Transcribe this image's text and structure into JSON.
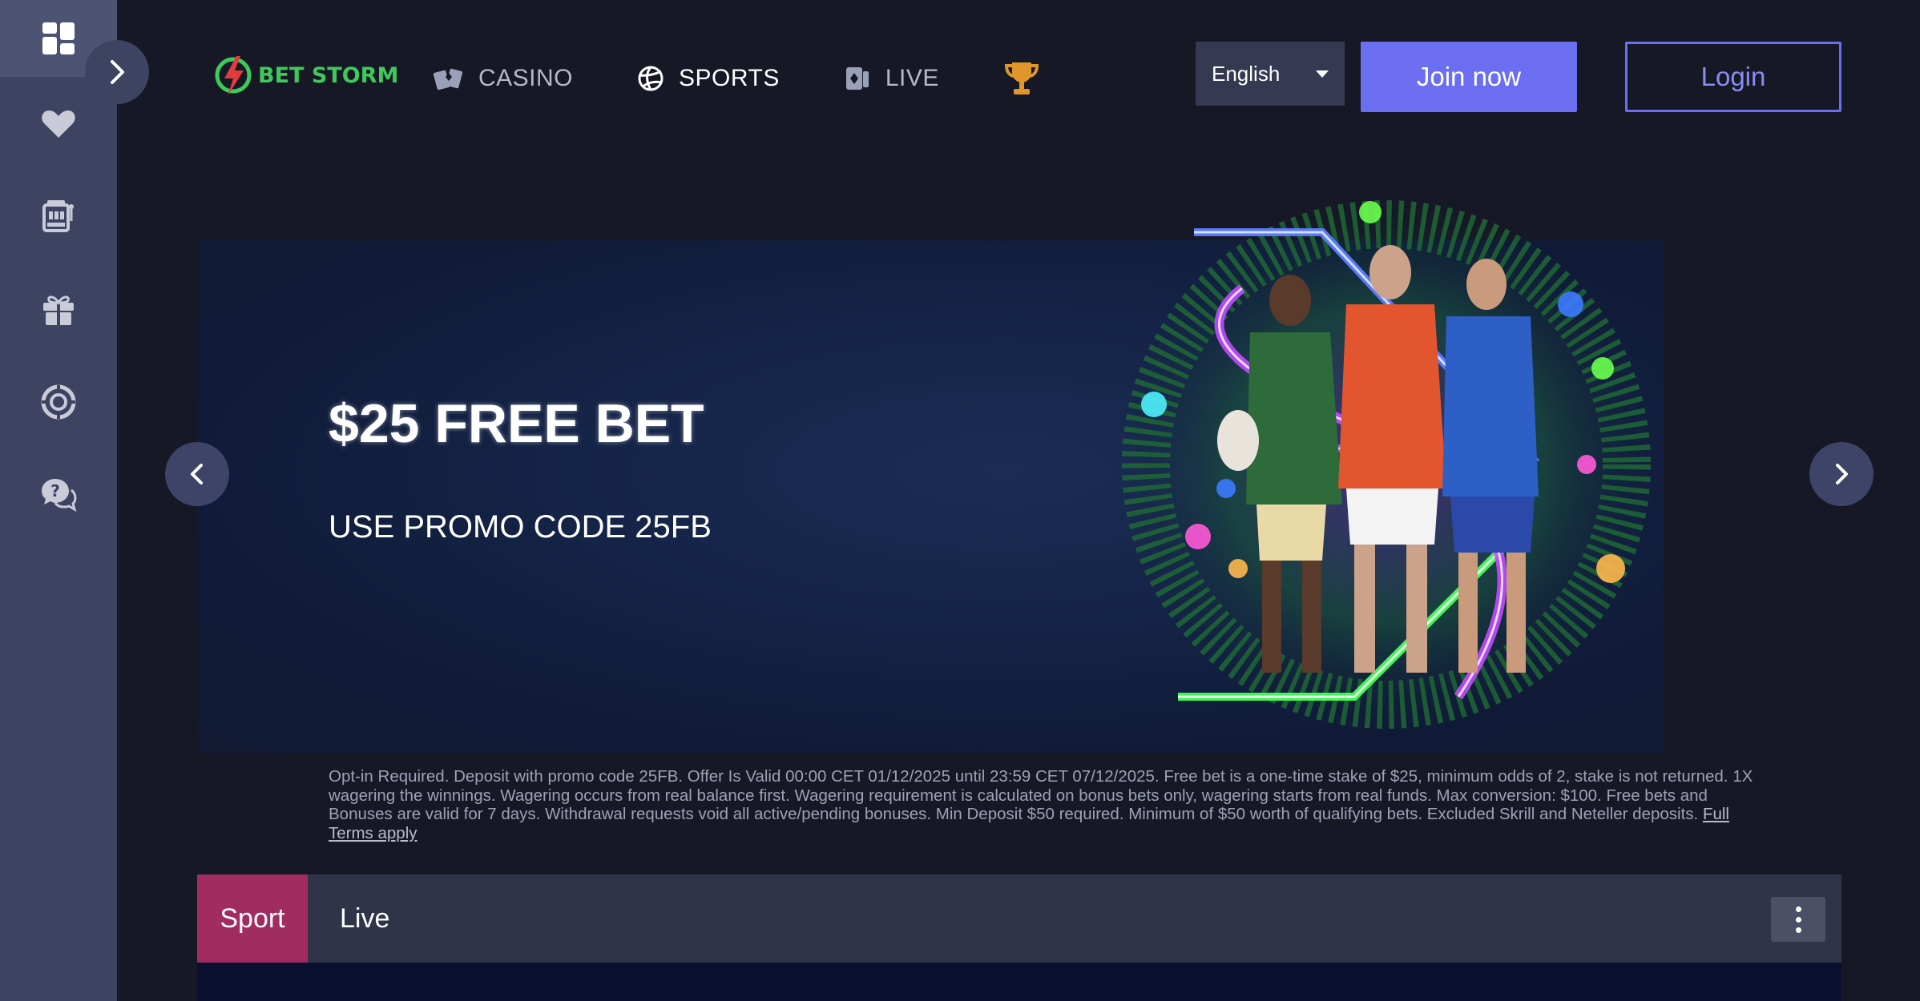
{
  "header": {
    "logo_text": "BET STORM",
    "nav": [
      {
        "label": "CASINO",
        "icon": "cards-icon"
      },
      {
        "label": "SPORTS",
        "icon": "volleyball-icon"
      },
      {
        "label": "LIVE",
        "icon": "live-cards-icon"
      },
      {
        "label": "",
        "icon": "trophy-icon"
      }
    ],
    "language": "English",
    "join_label": "Join now",
    "login_label": "Login"
  },
  "sidebar": {
    "items": [
      {
        "icon": "dashboard-icon"
      },
      {
        "icon": "heart-icon"
      },
      {
        "icon": "slot-machine-icon"
      },
      {
        "icon": "gift-icon"
      },
      {
        "icon": "poker-chip-icon"
      },
      {
        "icon": "help-chat-icon"
      }
    ]
  },
  "banner": {
    "title": "$25 FREE BET",
    "subtitle": "USE PROMO CODE 25FB"
  },
  "terms": {
    "text": "Opt-in Required. Deposit with promo code 25FB. Offer Is Valid 00:00 CET 01/12/2025 until 23:59 CET 07/12/2025. Free bet is a one-time stake of $25, minimum odds of 2, stake is not returned. 1X wagering the winnings. Wagering occurs from real balance first. Wagering requirement is calculated on bonus bets only, wagering starts from real funds. Max conversion: $100. Free bets and Bonuses are valid for 7 days. Withdrawal requests void all active/pending bonuses. Min Deposit $50 required. Minimum of $50 worth of qualifying bets. Excluded Skrill and Neteller deposits. ",
    "link": "Full Terms apply"
  },
  "tabs": {
    "sport": "Sport",
    "live": "Live"
  },
  "colors": {
    "accent": "#6c6ef2",
    "sport_tab": "#a12c60",
    "logo_green": "#3fc95b",
    "background": "#161826",
    "sidebar": "#3d4360"
  }
}
